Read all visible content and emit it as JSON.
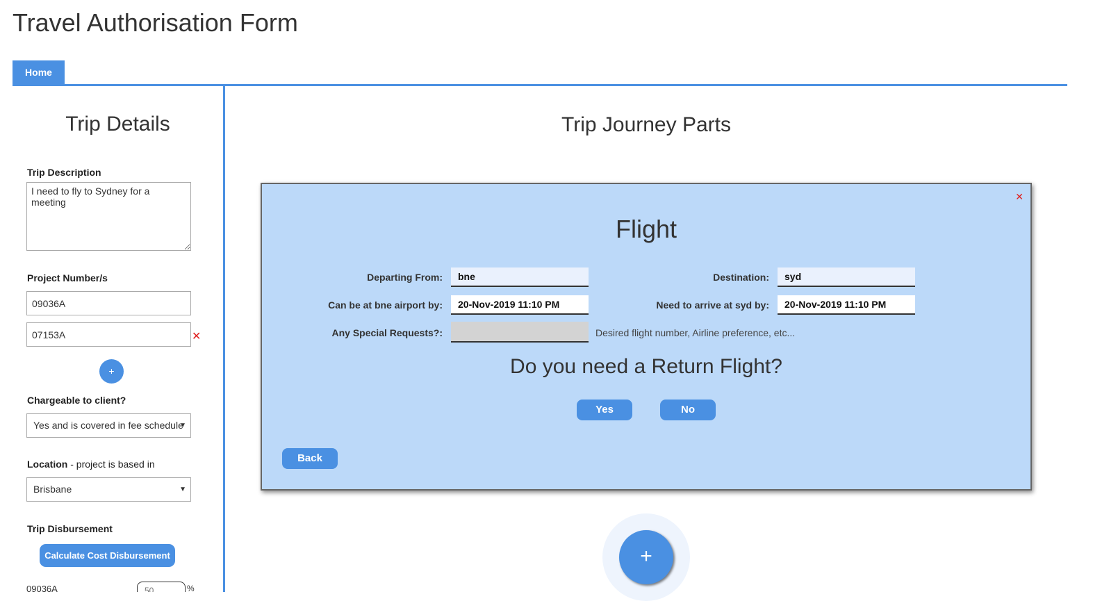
{
  "app_title": "Travel Authorisation Form",
  "tabs": [
    {
      "label": "Home",
      "active": true
    }
  ],
  "colors": {
    "accent": "#4a90e2",
    "card_bg": "#bcd9f9",
    "remove": "#e02020"
  },
  "sidebar": {
    "title": "Trip Details",
    "trip_description": {
      "label": "Trip Description",
      "value": "I need to fly to Sydney for a meeting"
    },
    "projects": {
      "label": "Project Number/s",
      "values": [
        "09036A",
        "07153A"
      ],
      "remove_icon": "✕",
      "add_icon": "+"
    },
    "chargeable": {
      "label": "Chargeable to client?",
      "selected": "Yes and is covered in fee schedule"
    },
    "location": {
      "label": "Location",
      "sublabel": " - project is based in",
      "selected": "Brisbane"
    },
    "disbursement": {
      "label": "Trip Disbursement",
      "button": "Calculate Cost Disbursement",
      "rows": [
        {
          "project": "09036A",
          "percent": "50",
          "unit": "%"
        }
      ]
    }
  },
  "main": {
    "title": "Trip Journey Parts",
    "flight": {
      "title": "Flight",
      "close_icon": "✕",
      "departing_from": {
        "label": "Departing From:",
        "value": "bne"
      },
      "destination": {
        "label": "Destination:",
        "value": "syd"
      },
      "airport_by": {
        "label": "Can be at bne airport by:",
        "value": "20-Nov-2019 11:10 PM"
      },
      "arrive_by": {
        "label": "Need to arrive at syd by:",
        "value": "20-Nov-2019 11:10 PM"
      },
      "special_requests": {
        "label": "Any Special Requests?:",
        "value": "",
        "hint": "Desired flight number, Airline preference, etc..."
      },
      "return_question": "Do you need a Return Flight?",
      "yes": "Yes",
      "no": "No",
      "back": "Back"
    },
    "add_part_icon": "+"
  }
}
